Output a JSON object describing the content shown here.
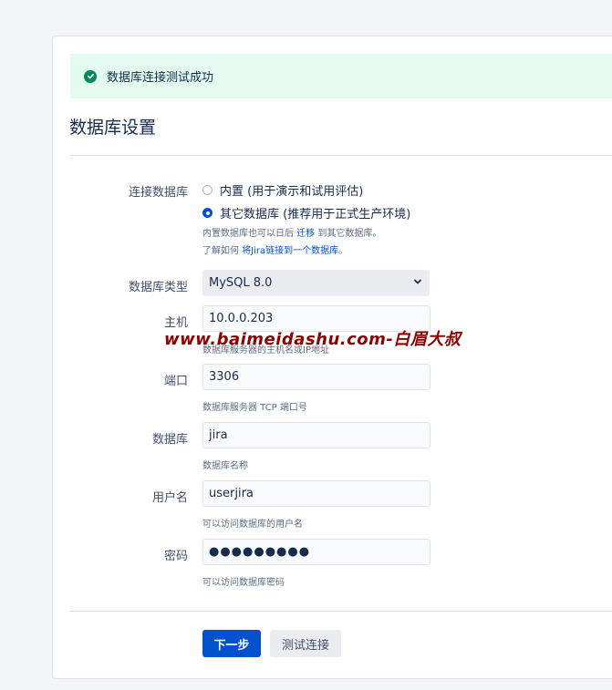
{
  "banner": {
    "message": "数据库连接测试成功",
    "color": "#00875a"
  },
  "page_title": "数据库设置",
  "connection": {
    "label": "连接数据库",
    "options": [
      {
        "label": "内置 (用于演示和试用评估)",
        "checked": false
      },
      {
        "label": "其它数据库 (推荐用于正式生产环境)",
        "checked": true
      }
    ],
    "note1_prefix": "内置数据库也可以日后",
    "note1_link": "迁移",
    "note1_suffix": "到其它数据库。",
    "note2_prefix": "了解如何",
    "note2_link": "将Jira链接到一个数据库",
    "note2_suffix": "。"
  },
  "db_type": {
    "label": "数据库类型",
    "value": "MySQL 8.0"
  },
  "host": {
    "label": "主机",
    "value": "10.0.0.203",
    "help": "数据库服务器的主机名或IP地址"
  },
  "port": {
    "label": "端口",
    "value": "3306",
    "help": "数据库服务器 TCP 端口号"
  },
  "database": {
    "label": "数据库",
    "value": "jira",
    "help": "数据库名称"
  },
  "username": {
    "label": "用户名",
    "value": "userjira",
    "help": "可以访问数据库的用户名"
  },
  "password": {
    "label": "密码",
    "value": "●●●●●●●●●",
    "help": "可以访问数据库密码"
  },
  "watermark": "www.baimeidashu.com-白眉大叔",
  "buttons": {
    "next": "下一步",
    "test": "测试连接"
  }
}
